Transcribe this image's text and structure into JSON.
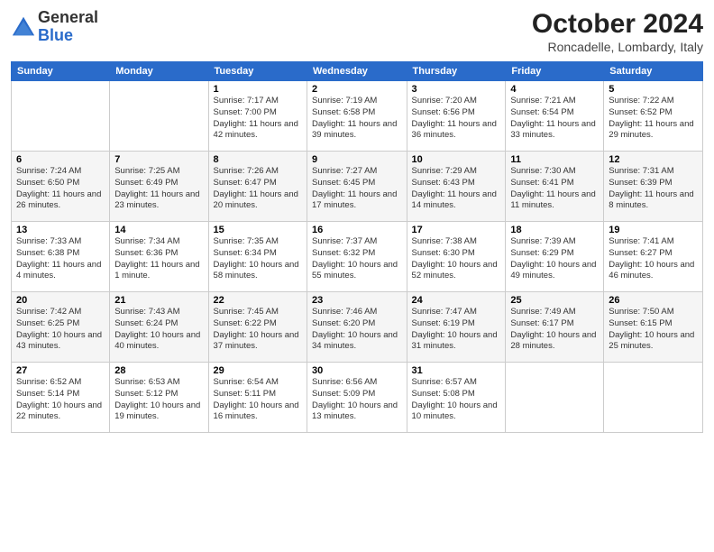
{
  "logo": {
    "general": "General",
    "blue": "Blue"
  },
  "header": {
    "month_year": "October 2024",
    "location": "Roncadelle, Lombardy, Italy"
  },
  "days_of_week": [
    "Sunday",
    "Monday",
    "Tuesday",
    "Wednesday",
    "Thursday",
    "Friday",
    "Saturday"
  ],
  "weeks": [
    [
      {
        "day": "",
        "sunrise": "",
        "sunset": "",
        "daylight": ""
      },
      {
        "day": "",
        "sunrise": "",
        "sunset": "",
        "daylight": ""
      },
      {
        "day": "1",
        "sunrise": "Sunrise: 7:17 AM",
        "sunset": "Sunset: 7:00 PM",
        "daylight": "Daylight: 11 hours and 42 minutes."
      },
      {
        "day": "2",
        "sunrise": "Sunrise: 7:19 AM",
        "sunset": "Sunset: 6:58 PM",
        "daylight": "Daylight: 11 hours and 39 minutes."
      },
      {
        "day": "3",
        "sunrise": "Sunrise: 7:20 AM",
        "sunset": "Sunset: 6:56 PM",
        "daylight": "Daylight: 11 hours and 36 minutes."
      },
      {
        "day": "4",
        "sunrise": "Sunrise: 7:21 AM",
        "sunset": "Sunset: 6:54 PM",
        "daylight": "Daylight: 11 hours and 33 minutes."
      },
      {
        "day": "5",
        "sunrise": "Sunrise: 7:22 AM",
        "sunset": "Sunset: 6:52 PM",
        "daylight": "Daylight: 11 hours and 29 minutes."
      }
    ],
    [
      {
        "day": "6",
        "sunrise": "Sunrise: 7:24 AM",
        "sunset": "Sunset: 6:50 PM",
        "daylight": "Daylight: 11 hours and 26 minutes."
      },
      {
        "day": "7",
        "sunrise": "Sunrise: 7:25 AM",
        "sunset": "Sunset: 6:49 PM",
        "daylight": "Daylight: 11 hours and 23 minutes."
      },
      {
        "day": "8",
        "sunrise": "Sunrise: 7:26 AM",
        "sunset": "Sunset: 6:47 PM",
        "daylight": "Daylight: 11 hours and 20 minutes."
      },
      {
        "day": "9",
        "sunrise": "Sunrise: 7:27 AM",
        "sunset": "Sunset: 6:45 PM",
        "daylight": "Daylight: 11 hours and 17 minutes."
      },
      {
        "day": "10",
        "sunrise": "Sunrise: 7:29 AM",
        "sunset": "Sunset: 6:43 PM",
        "daylight": "Daylight: 11 hours and 14 minutes."
      },
      {
        "day": "11",
        "sunrise": "Sunrise: 7:30 AM",
        "sunset": "Sunset: 6:41 PM",
        "daylight": "Daylight: 11 hours and 11 minutes."
      },
      {
        "day": "12",
        "sunrise": "Sunrise: 7:31 AM",
        "sunset": "Sunset: 6:39 PM",
        "daylight": "Daylight: 11 hours and 8 minutes."
      }
    ],
    [
      {
        "day": "13",
        "sunrise": "Sunrise: 7:33 AM",
        "sunset": "Sunset: 6:38 PM",
        "daylight": "Daylight: 11 hours and 4 minutes."
      },
      {
        "day": "14",
        "sunrise": "Sunrise: 7:34 AM",
        "sunset": "Sunset: 6:36 PM",
        "daylight": "Daylight: 11 hours and 1 minute."
      },
      {
        "day": "15",
        "sunrise": "Sunrise: 7:35 AM",
        "sunset": "Sunset: 6:34 PM",
        "daylight": "Daylight: 10 hours and 58 minutes."
      },
      {
        "day": "16",
        "sunrise": "Sunrise: 7:37 AM",
        "sunset": "Sunset: 6:32 PM",
        "daylight": "Daylight: 10 hours and 55 minutes."
      },
      {
        "day": "17",
        "sunrise": "Sunrise: 7:38 AM",
        "sunset": "Sunset: 6:30 PM",
        "daylight": "Daylight: 10 hours and 52 minutes."
      },
      {
        "day": "18",
        "sunrise": "Sunrise: 7:39 AM",
        "sunset": "Sunset: 6:29 PM",
        "daylight": "Daylight: 10 hours and 49 minutes."
      },
      {
        "day": "19",
        "sunrise": "Sunrise: 7:41 AM",
        "sunset": "Sunset: 6:27 PM",
        "daylight": "Daylight: 10 hours and 46 minutes."
      }
    ],
    [
      {
        "day": "20",
        "sunrise": "Sunrise: 7:42 AM",
        "sunset": "Sunset: 6:25 PM",
        "daylight": "Daylight: 10 hours and 43 minutes."
      },
      {
        "day": "21",
        "sunrise": "Sunrise: 7:43 AM",
        "sunset": "Sunset: 6:24 PM",
        "daylight": "Daylight: 10 hours and 40 minutes."
      },
      {
        "day": "22",
        "sunrise": "Sunrise: 7:45 AM",
        "sunset": "Sunset: 6:22 PM",
        "daylight": "Daylight: 10 hours and 37 minutes."
      },
      {
        "day": "23",
        "sunrise": "Sunrise: 7:46 AM",
        "sunset": "Sunset: 6:20 PM",
        "daylight": "Daylight: 10 hours and 34 minutes."
      },
      {
        "day": "24",
        "sunrise": "Sunrise: 7:47 AM",
        "sunset": "Sunset: 6:19 PM",
        "daylight": "Daylight: 10 hours and 31 minutes."
      },
      {
        "day": "25",
        "sunrise": "Sunrise: 7:49 AM",
        "sunset": "Sunset: 6:17 PM",
        "daylight": "Daylight: 10 hours and 28 minutes."
      },
      {
        "day": "26",
        "sunrise": "Sunrise: 7:50 AM",
        "sunset": "Sunset: 6:15 PM",
        "daylight": "Daylight: 10 hours and 25 minutes."
      }
    ],
    [
      {
        "day": "27",
        "sunrise": "Sunrise: 6:52 AM",
        "sunset": "Sunset: 5:14 PM",
        "daylight": "Daylight: 10 hours and 22 minutes."
      },
      {
        "day": "28",
        "sunrise": "Sunrise: 6:53 AM",
        "sunset": "Sunset: 5:12 PM",
        "daylight": "Daylight: 10 hours and 19 minutes."
      },
      {
        "day": "29",
        "sunrise": "Sunrise: 6:54 AM",
        "sunset": "Sunset: 5:11 PM",
        "daylight": "Daylight: 10 hours and 16 minutes."
      },
      {
        "day": "30",
        "sunrise": "Sunrise: 6:56 AM",
        "sunset": "Sunset: 5:09 PM",
        "daylight": "Daylight: 10 hours and 13 minutes."
      },
      {
        "day": "31",
        "sunrise": "Sunrise: 6:57 AM",
        "sunset": "Sunset: 5:08 PM",
        "daylight": "Daylight: 10 hours and 10 minutes."
      },
      {
        "day": "",
        "sunrise": "",
        "sunset": "",
        "daylight": ""
      },
      {
        "day": "",
        "sunrise": "",
        "sunset": "",
        "daylight": ""
      }
    ]
  ]
}
